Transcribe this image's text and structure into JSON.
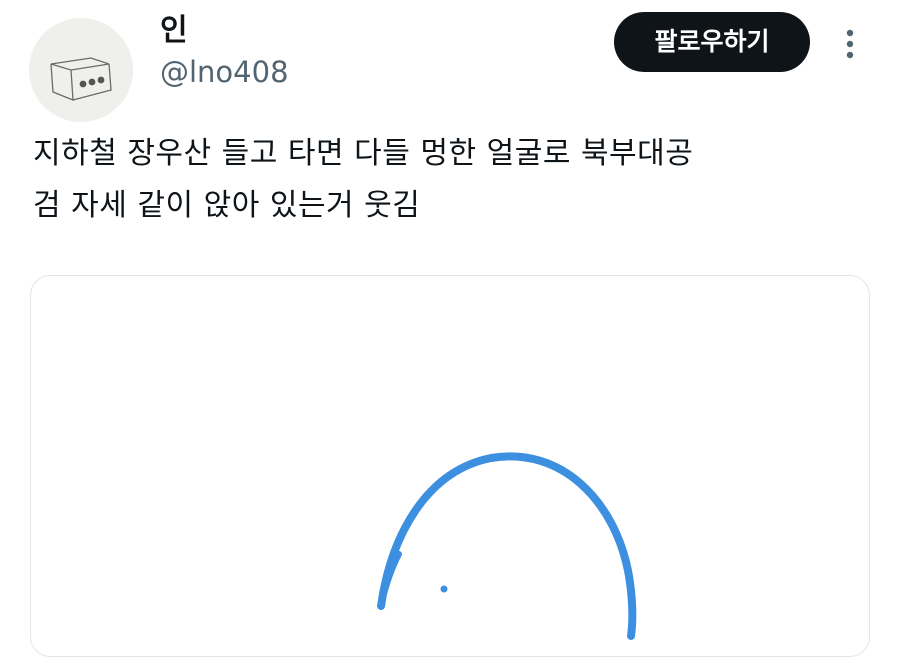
{
  "user": {
    "display_name": "인",
    "handle": "@lno408"
  },
  "follow_button": {
    "label": "팔로우하기"
  },
  "tweet": {
    "text_lines": [
      "지하철 장우산 들고 타면 다들 멍한 얼굴로 북부대공",
      "검 자세 같이 앉아 있는거 웃김"
    ]
  },
  "icons": {
    "more": "more-vertical-icon"
  },
  "colors": {
    "follow_bg": "#0f1419",
    "handle_text": "#536471",
    "drawing_stroke": "#3d8fe0"
  }
}
